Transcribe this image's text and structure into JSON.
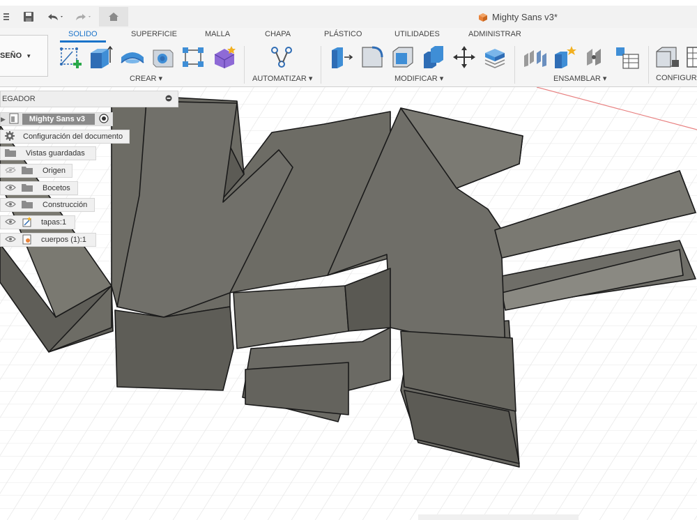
{
  "app": {
    "document_title": "Mighty Sans v3*"
  },
  "quick_access": {
    "items": [
      "save-icon",
      "undo-icon",
      "redo-icon",
      "home-icon"
    ]
  },
  "workspace": {
    "label": "SEÑO"
  },
  "ribbon": {
    "tabs": [
      {
        "label": "SOLIDO",
        "active": true
      },
      {
        "label": "SUPERFICIE",
        "active": false
      },
      {
        "label": "MALLA",
        "active": false
      },
      {
        "label": "CHAPA",
        "active": false
      },
      {
        "label": "PLÁSTICO",
        "active": false
      },
      {
        "label": "UTILIDADES",
        "active": false
      },
      {
        "label": "ADMINISTRAR",
        "active": false
      }
    ],
    "groups": [
      {
        "label": "CREAR ▾"
      },
      {
        "label": "AUTOMATIZAR ▾"
      },
      {
        "label": "MODIFICAR ▾"
      },
      {
        "label": "ENSAMBLAR ▾"
      },
      {
        "label": "CONFIGURA"
      }
    ]
  },
  "browser": {
    "header": "EGADOR",
    "root": "Mighty Sans v3",
    "items": [
      {
        "label": "Configuración del documento",
        "icon": "gear-icon",
        "eye": false
      },
      {
        "label": "Vistas guardadas",
        "icon": "folder-icon",
        "eye": false
      },
      {
        "label": "Origen",
        "icon": "folder-icon",
        "eye": true,
        "hidden": true
      },
      {
        "label": "Bocetos",
        "icon": "folder-icon",
        "eye": true
      },
      {
        "label": "Construcción",
        "icon": "folder-icon",
        "eye": true
      },
      {
        "label": "tapas:1",
        "icon": "component-icon",
        "eye": true
      },
      {
        "label": "cuerpos (1):1",
        "icon": "component-icon",
        "eye": true
      }
    ]
  },
  "colors": {
    "accent": "#1a73c9",
    "model_face": "#707068",
    "model_dark": "#5e5d57",
    "grid_line": "#e4e4e4",
    "axis_red": "#e88080"
  }
}
